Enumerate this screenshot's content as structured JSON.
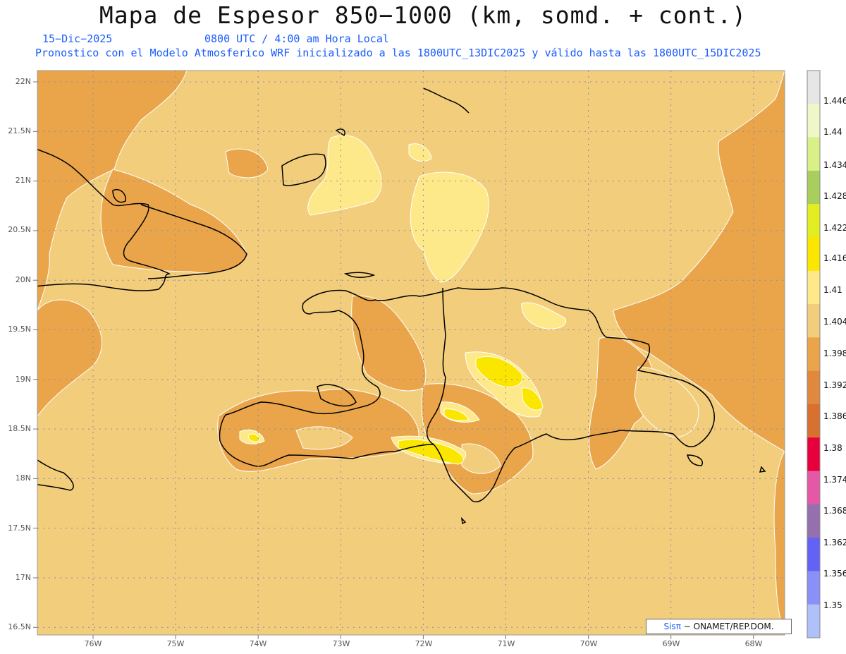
{
  "header": {
    "title": "Mapa de Espesor 850−1000 (km, somd. + cont.)",
    "date": "15−Dic−2025",
    "time": "0800 UTC / 4:00 am Hora Local",
    "forecast": "Pronostico con el Modelo Atmosferico WRF inicializado a las 1800UTC_13DIC2025 y válido hasta las  1800UTC_15DIC2025"
  },
  "axes": {
    "lat_labels": [
      "22N",
      "21.5N",
      "21N",
      "20.5N",
      "20N",
      "19.5N",
      "19N",
      "18.5N",
      "18N",
      "17.5N",
      "17N",
      "16.5N"
    ],
    "lon_labels": [
      "76W",
      "75W",
      "74W",
      "73W",
      "72W",
      "71W",
      "70W",
      "69W",
      "68W"
    ]
  },
  "legend": {
    "labels": [
      "1.446",
      "1.44",
      "1.434",
      "1.428",
      "1.422",
      "1.416",
      "1.41",
      "1.404",
      "1.398",
      "1.392",
      "1.386",
      "1.38",
      "1.374",
      "1.368",
      "1.362",
      "1.356",
      "1.35"
    ],
    "colors": [
      "#e6e6e6",
      "#eff6c8",
      "#d9f088",
      "#a8cf5d",
      "#e2ee22",
      "#fbe600",
      "#fde98a",
      "#f2cd7c",
      "#eaa54a",
      "#e0893e",
      "#d87030",
      "#e8003c",
      "#e558a6",
      "#9670ae",
      "#6262f4",
      "#8a90f8",
      "#b0c0f8"
    ]
  },
  "credit": {
    "logo": "Sisπ",
    "text": "− ONAMET/REP.DOM."
  }
}
